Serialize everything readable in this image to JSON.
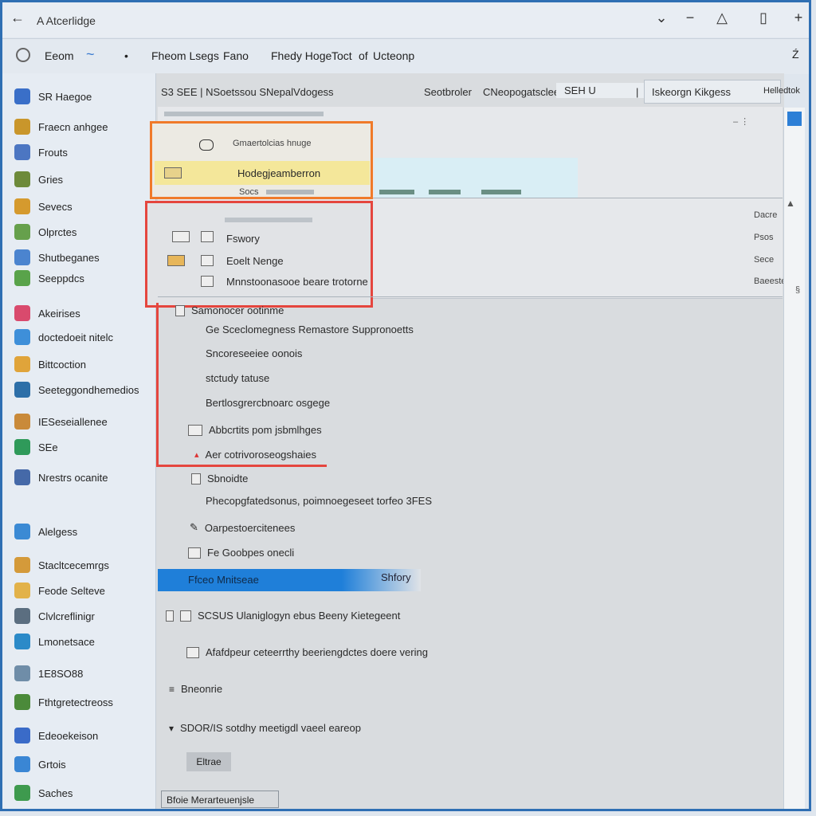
{
  "window": {
    "title": "A Atcerlidge"
  },
  "titlebar": {
    "back": "←",
    "controls": [
      "⌄",
      "−",
      "△",
      "▯",
      "+"
    ]
  },
  "toolbar": {
    "items": [
      "Eeom",
      "~",
      "•",
      "Fheom Lsegs",
      "Fano",
      "Fhedy Hoge",
      "Toct",
      "of",
      "Ucteonp",
      "Ź"
    ]
  },
  "sidebar": {
    "items": [
      {
        "label": "SR Haegoe",
        "icon": "shield-icon",
        "color": "#3a6fc8"
      },
      {
        "label": "Fraecn anhgee",
        "icon": "globe-icon",
        "color": "#c9962b"
      },
      {
        "label": "Frouts",
        "icon": "cloud-icon",
        "color": "#4c76c2"
      },
      {
        "label": "Gries",
        "icon": "grid-icon",
        "color": "#6d8a3a"
      },
      {
        "label": "Sevecs",
        "icon": "folder-icon",
        "color": "#d59a2e"
      },
      {
        "label": "Olprctes",
        "icon": "doc-icon",
        "color": "#66a04c"
      },
      {
        "label": "Shutbeganes",
        "icon": "tablet-icon",
        "color": "#4b84cf"
      },
      {
        "label": "Seeppdcs",
        "icon": "leaf-icon",
        "color": "#59a34a"
      },
      {
        "label": "Akeirises",
        "icon": "heart-icon",
        "color": "#d94a6d"
      },
      {
        "label": "doctedoeit nitelc",
        "icon": "window-icon",
        "color": "#3e8fd9"
      },
      {
        "label": "Bittcoction",
        "icon": "box-icon",
        "color": "#e0a43a"
      },
      {
        "label": "Seeteggondhemedios",
        "icon": "eye-icon",
        "color": "#2d6fa8"
      },
      {
        "label": "IESeseiallenee",
        "icon": "key-icon",
        "color": "#c98a3a"
      },
      {
        "label": "SEe",
        "icon": "gear-icon",
        "color": "#2f9a5a"
      },
      {
        "label": "Nrestrs ocanite",
        "icon": "truck-icon",
        "color": "#4569a8"
      },
      {
        "label": "Alelgess",
        "icon": "plane-icon",
        "color": "#3b8ad4"
      },
      {
        "label": "Stacltcecemrgs",
        "icon": "chest-icon",
        "color": "#d49a3a"
      },
      {
        "label": "Feode Selteve",
        "icon": "folder2-icon",
        "color": "#e2b24a"
      },
      {
        "label": "Clvlcreflinigr",
        "icon": "film-icon",
        "color": "#5b6e80"
      },
      {
        "label": "Lmonetsace",
        "icon": "globe2-icon",
        "color": "#2b8ac8"
      },
      {
        "label": "1E8SO88",
        "icon": "phone-icon",
        "color": "#6f8da8"
      },
      {
        "label": "Fthtgretectreoss",
        "icon": "pen-icon",
        "color": "#4b8a3a"
      },
      {
        "label": "Edeoekeison",
        "icon": "briefcase-icon",
        "color": "#3a6bc8"
      },
      {
        "label": "Grtois",
        "icon": "mail-icon",
        "color": "#3a86d4"
      },
      {
        "label": "Saches",
        "icon": "tree-icon",
        "color": "#3e9a4e"
      }
    ]
  },
  "header": {
    "left": "S3 SEE | NSoetssou SNepalVdogess",
    "middle_a": "Seotbroler",
    "middle_b": "CNeopogatsclee",
    "middle_c": "SEH U",
    "right": "Iskeorgn Kikgess",
    "far_right": "Helledtok"
  },
  "panel": {
    "orange": {
      "title": "Gmaertolcias hnuge",
      "row": "Hodegjeamberron",
      "foot": "Socs"
    },
    "red": {
      "items": [
        "Fswory",
        "Eoelt Nenge",
        "Mnnstoonasooe beare trotorne"
      ]
    },
    "right_labels": [
      "Dacre",
      "Psos",
      "Sece",
      "Baeeste"
    ]
  },
  "tree": {
    "items": [
      "Samonocer ootinme",
      "Ge Sceclomegness Remastore Suppronoetts",
      "Sncoreseeiee oonois",
      "stctudy tatuse",
      "Bertlosgrercbnoarc osgege",
      "Abbcrtits pom jsbmlhges",
      "Aer cotrivoroseogshaies",
      "Sbnoidte",
      "Phecopgfatedsonus, poimnoegeseet torfeo 3FES",
      "Oarpestoercitenees",
      "Fe Goobpes onecli"
    ],
    "selected": "Ffceo Mnitseae",
    "selected_right": "Shfory",
    "more": [
      "SCSUS Ulaniglogyn ebus Beeny Kietegeent",
      "Afafdpeur ceteerrthy beeriengdctes doere vering",
      "Bneonrie",
      "SDOR/IS sotdhy meetigdl vaeel eareop"
    ],
    "pill": "Eltrae",
    "bottom": "Bfoie Merarteuenjsle"
  }
}
